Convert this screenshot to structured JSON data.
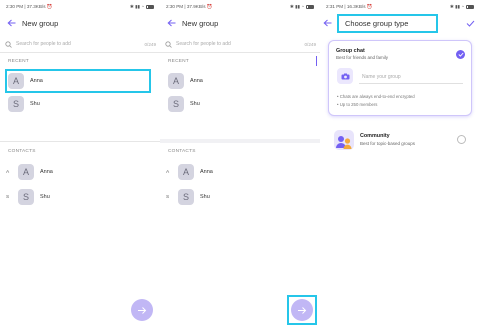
{
  "screen1": {
    "status_left": "2:30 PM | 37.3KB/s ⏰",
    "title": "New group",
    "search_placeholder": "Search for people to add",
    "counter": "0/249",
    "recent_label": "RECENT",
    "recent": [
      {
        "initial": "A",
        "name": "Anna"
      },
      {
        "initial": "S",
        "name": "Shu"
      }
    ],
    "contacts_label": "CONTACTS",
    "contacts": [
      {
        "index": "A",
        "initial": "A",
        "name": "Anna"
      },
      {
        "index": "S",
        "initial": "S",
        "name": "Shu"
      }
    ]
  },
  "screen2": {
    "status_left": "2:30 PM | 37.9KB/s ⏰",
    "title": "New group",
    "search_placeholder": "Search for people to add",
    "counter": "0/249",
    "recent_label": "RECENT",
    "recent": [
      {
        "initial": "A",
        "name": "Anna"
      },
      {
        "initial": "S",
        "name": "Shu"
      }
    ],
    "contacts_label": "CONTACTS",
    "contacts": [
      {
        "index": "A",
        "initial": "A",
        "name": "Anna"
      },
      {
        "index": "S",
        "initial": "S",
        "name": "Shu"
      }
    ]
  },
  "screen3": {
    "status_left": "2:31 PM | 16.3KB/s ⏰",
    "title": "Choose group type",
    "group_chat_title": "Group chat",
    "group_chat_sub": "Best for friends and family",
    "group_name_placeholder": "Name your group",
    "bullet1": "• Chats are always end-to-end encrypted",
    "bullet2": "• Up to 250 members",
    "community_title": "Community",
    "community_sub": "Best for topic-based groups"
  },
  "colors": {
    "accent": "#7360f2",
    "fab": "#c1b7f5",
    "highlight": "#25c6e9",
    "avatar_bg": "#d4d4e0"
  },
  "icons": [
    "back-arrow-icon",
    "search-icon",
    "arrow-right-icon",
    "checkmark-icon",
    "camera-icon",
    "radio-selected-icon",
    "radio-unselected-icon",
    "community-avatar-icon"
  ]
}
